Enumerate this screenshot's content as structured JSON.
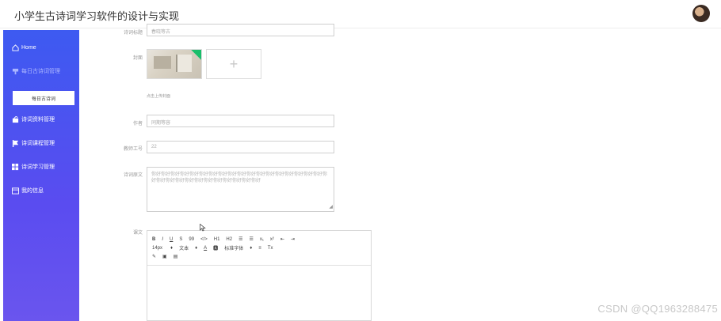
{
  "app": {
    "title": "小学生古诗词学习软件的设计与实现"
  },
  "sidebar": {
    "items": [
      {
        "icon": "home-icon",
        "label": "Home"
      },
      {
        "icon": "trophy-icon",
        "label": "每日古诗词管理"
      },
      {
        "icon": "bulletin-icon",
        "label": "诗词资料管理"
      },
      {
        "icon": "flag-icon",
        "label": "诗词课程管理"
      },
      {
        "icon": "grid-icon",
        "label": "诗词学习管理"
      },
      {
        "icon": "profile-icon",
        "label": "我的信息"
      }
    ],
    "sub_active": "每日古诗词"
  },
  "form": {
    "top_label": "诗词标题",
    "top_value": "春晓等古",
    "cover_label": "封面",
    "cover_hint": "点击上传封面",
    "author_label": "作者",
    "author_value": "同期等容",
    "teacher_id_label": "教师工号",
    "teacher_id_value": "22",
    "original_label": "诗词原文",
    "original_value": "你好你好你好你好你好你好你好你好你好你好你好你好你好你好你好你好你好你好你好你好你好你好你好你好你好你好你好你好你好你好",
    "content_label": "课文"
  },
  "editor": {
    "row1": [
      "B",
      "I",
      "U",
      "S",
      "99",
      "</>",
      "H1",
      "H2",
      "☰",
      "☰",
      "x₁",
      "x²",
      "⇤",
      "⇥"
    ],
    "row2": [
      "14px",
      "♦",
      "文本",
      "♦",
      "A",
      "🅰",
      "标准字体",
      "♦",
      "≡",
      "Tx"
    ],
    "row3": [
      "✎",
      "▣",
      "▤"
    ]
  },
  "watermark": "CSDN @QQ1963288475"
}
